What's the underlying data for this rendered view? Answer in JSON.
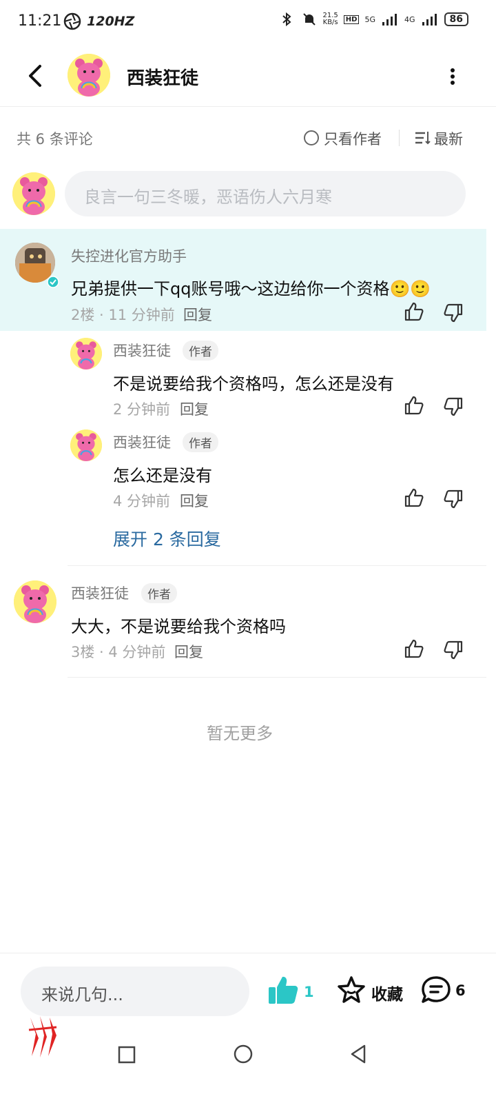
{
  "status_bar": {
    "time": "11:21",
    "refresh": "120HZ",
    "speed": "21.5\nKB/s",
    "hd": "HD",
    "net5g": "5G",
    "net4g": "4G",
    "battery": "86"
  },
  "header": {
    "title": "西装狂徒"
  },
  "meta": {
    "count": "共 6 条评论",
    "only_author": "只看作者",
    "sort": "最新"
  },
  "input": {
    "placeholder": "良言一句三冬暖，恶语伤人六月寒"
  },
  "comments": [
    {
      "name": "失控进化官方助手",
      "content": "兄弟提供一下qq账号哦～这边给你一个资格🙂🙂",
      "sub": "2楼 · 11 分钟前",
      "reply": "回复"
    },
    {
      "name": "西装狂徒",
      "tag": "作者",
      "content": "不是说要给我个资格吗，怎么还是没有",
      "sub": "2 分钟前",
      "reply": "回复"
    },
    {
      "name": "西装狂徒",
      "tag": "作者",
      "content": "怎么还是没有",
      "sub": "4 分钟前",
      "reply": "回复"
    },
    {
      "name": "西装狂徒",
      "tag": "作者",
      "content": "大大，不是说要给我个资格吗",
      "sub": "3楼 · 4 分钟前",
      "reply": "回复"
    }
  ],
  "expand": "展开 2 条回复",
  "no_more": "暂无更多",
  "bottom": {
    "placeholder": "来说几句...",
    "like_count": "1",
    "collect": "收藏",
    "comment_count": "6"
  },
  "colors": {
    "accent": "#2bc6c6",
    "highlight": "#e6f8f8",
    "link": "#2a6aa0"
  }
}
